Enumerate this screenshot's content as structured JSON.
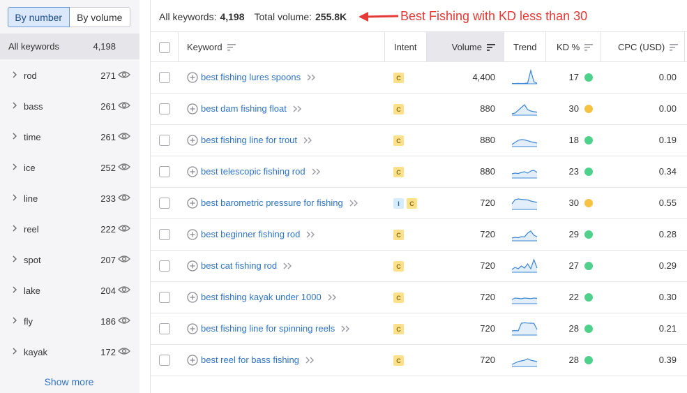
{
  "sidebar": {
    "toggle": {
      "by_number": "By number",
      "by_volume": "By volume"
    },
    "all_keywords": {
      "label": "All keywords",
      "count": "4,198"
    },
    "groups": [
      {
        "name": "rod",
        "count": "271"
      },
      {
        "name": "bass",
        "count": "261"
      },
      {
        "name": "time",
        "count": "261"
      },
      {
        "name": "ice",
        "count": "252"
      },
      {
        "name": "line",
        "count": "233"
      },
      {
        "name": "reel",
        "count": "222"
      },
      {
        "name": "spot",
        "count": "207"
      },
      {
        "name": "lake",
        "count": "204"
      },
      {
        "name": "fly",
        "count": "186"
      },
      {
        "name": "kayak",
        "count": "172"
      }
    ],
    "show_more": "Show more"
  },
  "summary": {
    "all_keywords_label": "All keywords:",
    "all_keywords_value": "4,198",
    "total_volume_label": "Total volume:",
    "total_volume_value": "255.8K"
  },
  "annotation": {
    "text": "Best Fishing with KD less than 30",
    "color": "#e53935"
  },
  "table": {
    "columns": {
      "keyword": "Keyword",
      "intent": "Intent",
      "volume": "Volume",
      "trend": "Trend",
      "kd": "KD %",
      "cpc": "CPC (USD)"
    },
    "kd_colors": {
      "green": "#4fd18b",
      "yellow": "#f5c242"
    },
    "rows": [
      {
        "keyword": "best fishing lures spoons",
        "intents": [
          "C"
        ],
        "volume": "4,400",
        "kd": "17",
        "kd_level": "green",
        "cpc": "0.00",
        "trend": [
          0.02,
          0.02,
          0.03,
          0.02,
          0.03,
          0.05,
          0.95,
          0.15,
          0.03
        ]
      },
      {
        "keyword": "best dam fishing float",
        "intents": [
          "C"
        ],
        "volume": "880",
        "kd": "30",
        "kd_level": "yellow",
        "cpc": "0.00",
        "trend": [
          0.1,
          0.15,
          0.35,
          0.55,
          0.75,
          0.4,
          0.3,
          0.25,
          0.22
        ]
      },
      {
        "keyword": "best fishing line for trout",
        "intents": [
          "C"
        ],
        "volume": "880",
        "kd": "18",
        "kd_level": "green",
        "cpc": "0.19",
        "trend": [
          0.15,
          0.3,
          0.45,
          0.5,
          0.48,
          0.42,
          0.35,
          0.3,
          0.25
        ]
      },
      {
        "keyword": "best telescopic fishing rod",
        "intents": [
          "C"
        ],
        "volume": "880",
        "kd": "23",
        "kd_level": "green",
        "cpc": "0.34",
        "trend": [
          0.3,
          0.35,
          0.32,
          0.4,
          0.45,
          0.35,
          0.5,
          0.55,
          0.4
        ]
      },
      {
        "keyword": "best barometric pressure for fishing",
        "intents": [
          "I",
          "C"
        ],
        "volume": "720",
        "kd": "30",
        "kd_level": "yellow",
        "cpc": "0.55",
        "trend": [
          0.4,
          0.7,
          0.75,
          0.72,
          0.7,
          0.68,
          0.6,
          0.55,
          0.5
        ]
      },
      {
        "keyword": "best beginner fishing rod",
        "intents": [
          "C"
        ],
        "volume": "720",
        "kd": "29",
        "kd_level": "green",
        "cpc": "0.28",
        "trend": [
          0.2,
          0.25,
          0.22,
          0.3,
          0.28,
          0.55,
          0.7,
          0.4,
          0.3
        ]
      },
      {
        "keyword": "best cat fishing rod",
        "intents": [
          "C"
        ],
        "volume": "720",
        "kd": "27",
        "kd_level": "green",
        "cpc": "0.29",
        "trend": [
          0.2,
          0.35,
          0.25,
          0.45,
          0.3,
          0.6,
          0.25,
          0.9,
          0.3
        ]
      },
      {
        "keyword": "best fishing kayak under 1000",
        "intents": [
          "C"
        ],
        "volume": "720",
        "kd": "22",
        "kd_level": "green",
        "cpc": "0.30",
        "trend": [
          0.3,
          0.4,
          0.38,
          0.35,
          0.4,
          0.38,
          0.36,
          0.4,
          0.38
        ]
      },
      {
        "keyword": "best fishing line for spinning reels",
        "intents": [
          "C"
        ],
        "volume": "720",
        "kd": "28",
        "kd_level": "green",
        "cpc": "0.21",
        "trend": [
          0.3,
          0.32,
          0.3,
          0.85,
          0.88,
          0.86,
          0.85,
          0.84,
          0.4
        ]
      },
      {
        "keyword": "best reel for bass fishing",
        "intents": [
          "C"
        ],
        "volume": "720",
        "kd": "28",
        "kd_level": "green",
        "cpc": "0.39",
        "trend": [
          0.15,
          0.25,
          0.35,
          0.4,
          0.45,
          0.55,
          0.45,
          0.4,
          0.35
        ]
      }
    ]
  }
}
